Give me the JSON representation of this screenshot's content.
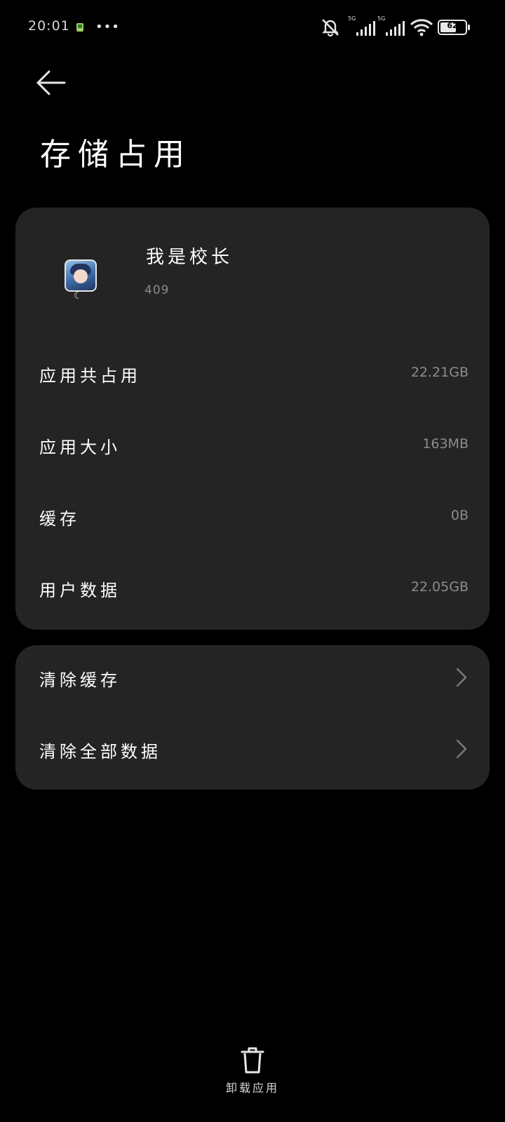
{
  "status_bar": {
    "time": "20:01",
    "more": "•••",
    "network_1": "5G",
    "network_2": "5G",
    "battery": "62"
  },
  "page": {
    "title": "存储占用"
  },
  "app": {
    "name": "我是校长",
    "version": "409"
  },
  "storage": [
    {
      "label": "应用共占用",
      "value": "22.21GB"
    },
    {
      "label": "应用大小",
      "value": "163MB"
    },
    {
      "label": "缓存",
      "value": "0B"
    },
    {
      "label": "用户数据",
      "value": "22.05GB"
    }
  ],
  "actions": [
    {
      "label": "清除缓存"
    },
    {
      "label": "清除全部数据"
    }
  ],
  "footer": {
    "uninstall_label": "卸载应用"
  },
  "colors": {
    "background": "#000000",
    "card": "#242424",
    "secondary_text": "#8c8c8c"
  }
}
